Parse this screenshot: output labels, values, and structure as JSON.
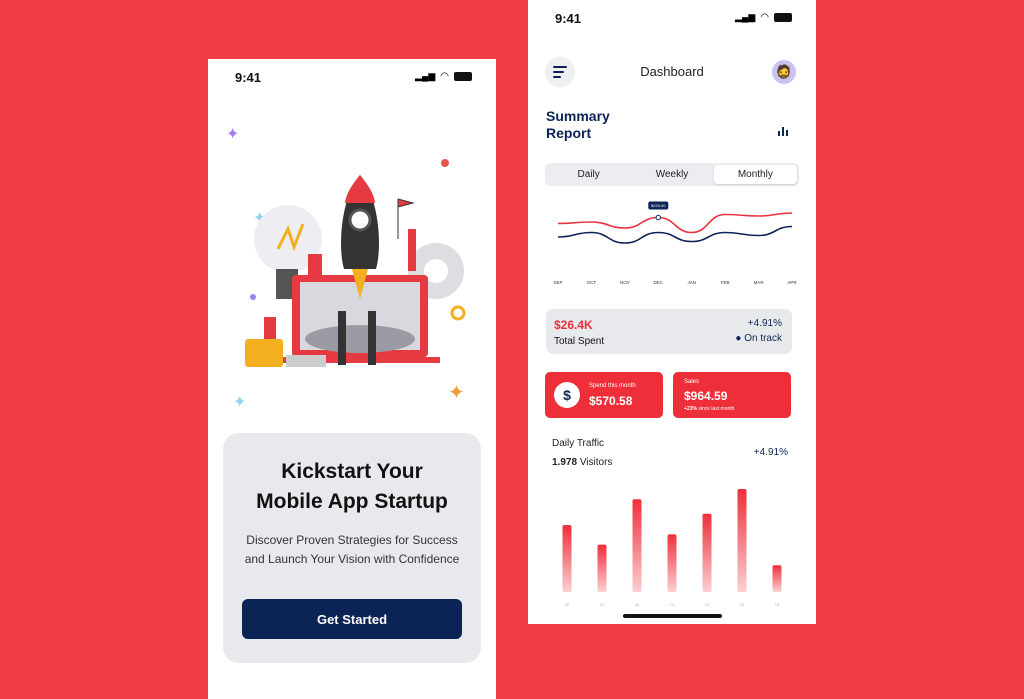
{
  "onboarding": {
    "status_time": "9:41",
    "title_line1": "Kickstart Your",
    "title_line2": "Mobile App Startup",
    "description": "Discover Proven Strategies for Success and Launch Your Vision with Confidence",
    "cta_label": "Get Started"
  },
  "dashboard": {
    "status_time": "9:41",
    "header_title": "Dashboard",
    "section_title_line1": "Summary",
    "section_title_line2": "Report",
    "tabs": [
      {
        "label": "Daily"
      },
      {
        "label": "Weekly"
      },
      {
        "label": "Monthly",
        "active": true
      }
    ],
    "total_spent": {
      "value": "$26.4K",
      "label": "Total Spent",
      "change": "+4.91%",
      "status": "On track"
    },
    "spend_card": {
      "label": "Spend this month",
      "value": "$570.58"
    },
    "sales_card": {
      "label": "Sales",
      "value": "$964.59",
      "change": "+23%",
      "change_suffix": "since last month"
    },
    "traffic": {
      "title": "Daily Traffic",
      "visitors_count": "1.978",
      "visitors_label": "Visitors",
      "change": "+4.91%"
    },
    "colors": {
      "accent": "#EE2F3A",
      "navy": "#0C2356",
      "background": "#F23C44"
    }
  },
  "chart_data": [
    {
      "type": "line",
      "categories": [
        "SEP",
        "OCT",
        "NOV",
        "DEC",
        "JAN",
        "FEB",
        "MAR",
        "APR"
      ],
      "series": [
        {
          "values": [
            62,
            64,
            56,
            70,
            50,
            74,
            72,
            76
          ],
          "color": "#EE2F3A"
        },
        {
          "values": [
            44,
            50,
            36,
            50,
            38,
            50,
            46,
            58
          ],
          "color": "#0C2356"
        }
      ],
      "tooltip": {
        "category": "DEC",
        "label": "$220.00"
      },
      "grid": false
    },
    {
      "type": "bar",
      "categories": [
        "00",
        "04",
        "08",
        "12",
        "14",
        "16",
        "18"
      ],
      "values": [
        65,
        46,
        90,
        56,
        76,
        100,
        26
      ],
      "color": "#EE2F3A",
      "grid": false
    }
  ]
}
